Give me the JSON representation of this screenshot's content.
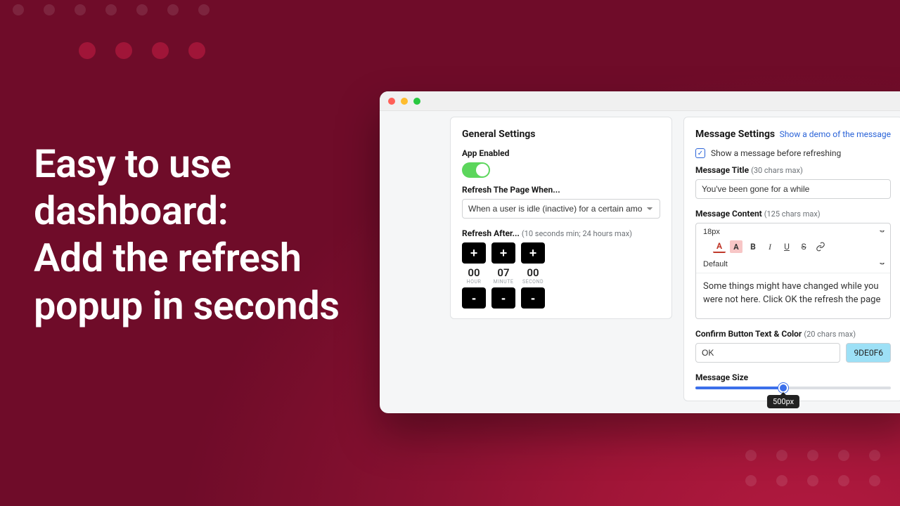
{
  "tagline": "Easy to use\ndashboard:\nAdd the refresh\npopup in seconds",
  "general": {
    "title": "General Settings",
    "app_enabled_label": "App Enabled",
    "app_enabled": true,
    "refresh_when_label": "Refresh The Page When...",
    "refresh_when_value": "When a user is idle (inactive) for a certain amount of time",
    "refresh_after_label": "Refresh After...",
    "refresh_after_hint": "(10 seconds min; 24 hours max)",
    "time": {
      "hour": "00",
      "minute": "07",
      "second": "00",
      "hour_label": "HOUR",
      "minute_label": "MINUTE",
      "second_label": "SECOND",
      "plus": "+",
      "minus": "-"
    }
  },
  "message": {
    "title": "Message Settings",
    "demo_link": "Show a demo of the message",
    "show_before_label": "Show a message before refreshing",
    "show_before_checked": true,
    "title_label": "Message Title",
    "title_hint": "(30 chars max)",
    "title_value": "You've been gone for a while",
    "content_label": "Message Content",
    "content_hint": "(125 chars max)",
    "content_value": "Some things might have changed while you were not here. Click OK the refresh the page",
    "editor": {
      "font_size": "18px",
      "font_family": "Default"
    },
    "confirm_label": "Confirm Button Text & Color",
    "confirm_hint": "(20 chars max)",
    "confirm_value": "OK",
    "confirm_color": "9DE0F6",
    "size_label": "Message Size",
    "size_value": "500px",
    "size_percent": 45
  }
}
